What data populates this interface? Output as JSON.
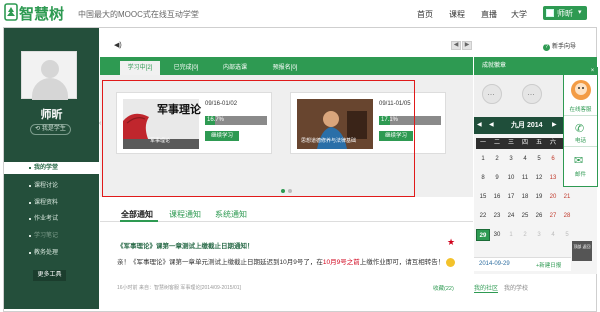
{
  "header": {
    "logo_text": "智慧树",
    "slogan": "中国最大的MOOC式在线互动学堂",
    "nav": [
      "首页",
      "课程",
      "直播",
      "大学"
    ],
    "user_name": "师昕"
  },
  "sidebar": {
    "name": "师昕",
    "role": "我是学生",
    "items": [
      "我的学堂",
      "课程讨论",
      "课程资料",
      "作业考试",
      "学习笔记",
      "教务处理"
    ],
    "more_tools": "更多工具"
  },
  "course_tabs": [
    "学习中[2]",
    "已完成[0]",
    "内部选课",
    "预报名[0]"
  ],
  "courses": [
    {
      "title": "军事理论",
      "subtitle": "军事理论",
      "dates": "09/16-01/02",
      "progress_text": "16.7%",
      "progress": 0.167,
      "button": "继续学习"
    },
    {
      "title": "思想道德修养与法律基础",
      "subtitle": "思想道德修养与法律基础",
      "dates": "09/11-01/05",
      "progress_text": "17.1%",
      "progress": 0.171,
      "button": "继续学习"
    }
  ],
  "notice_tabs": [
    "全部通知",
    "课程通知",
    "系统通知"
  ],
  "notice": {
    "title": "《军事理论》课第一章测试上缴截止日期通知！",
    "body_pre": "亲！《军事理论》课第一章单元测试上缴截止日期延迟到10月9号了，在",
    "body_red": "10月9号之前",
    "body_post": "上缴作业即可，请互相转告！",
    "meta": "16小时前 来自：智慧树客服 军事理论[2014/09-2015/01]",
    "fav": "收藏(22)"
  },
  "right": {
    "help": "新手向导",
    "badges_title": "成就徽章",
    "calendar": {
      "title": "九月 2014",
      "weekdays": [
        "一",
        "二",
        "三",
        "四",
        "五",
        "六",
        "日"
      ],
      "weeks": [
        [
          "1",
          "2",
          "3",
          "4",
          "5",
          "6",
          "7"
        ],
        [
          "8",
          "9",
          "10",
          "11",
          "12",
          "13",
          "14"
        ],
        [
          "15",
          "16",
          "17",
          "18",
          "19",
          "20",
          "21"
        ],
        [
          "22",
          "23",
          "24",
          "25",
          "26",
          "27",
          "28"
        ],
        [
          "29",
          "30",
          "1",
          "2",
          "3",
          "4",
          "5"
        ]
      ],
      "today": "29",
      "selected_date": "2014-09-29",
      "new_log": "+新建日报"
    },
    "community_tabs": [
      "我的社区",
      "我的学校"
    ]
  },
  "float_widget": {
    "items": [
      "在线客服",
      "电话",
      "邮件"
    ],
    "close": "×",
    "scroll_top": "顶部 返回"
  }
}
